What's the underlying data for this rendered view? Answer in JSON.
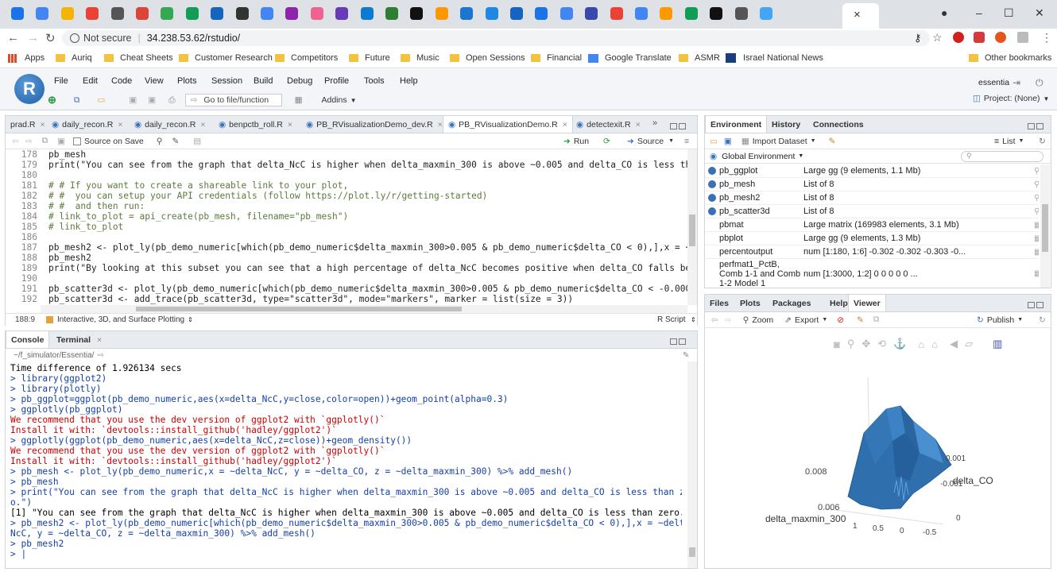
{
  "browser": {
    "active_tab_close": "×",
    "security": "Not secure",
    "url": "34.238.53.62/rstudio/",
    "bookmarks": [
      "Apps",
      "Auriq",
      "Cheat Sheets",
      "Customer Research",
      "Competitors",
      "Future",
      "Music",
      "Open Sessions",
      "Financial",
      "Google Translate",
      "ASMR",
      "Israel National News"
    ],
    "other_bookmarks": "Other bookmarks"
  },
  "menubar": {
    "items": [
      "File",
      "Edit",
      "Code",
      "View",
      "Plots",
      "Session",
      "Build",
      "Debug",
      "Profile",
      "Tools",
      "Help"
    ],
    "user": "essentia",
    "project": "Project: (None)",
    "goto": "Go to file/function",
    "addins": "Addins"
  },
  "editor": {
    "tabs": [
      "prad.R",
      "daily_recon.R",
      "daily_recon.R",
      "benpctb_roll.R",
      "PB_RVisualizationDemo_dev.R",
      "PB_RVisualizationDemo.R",
      "detectexit.R"
    ],
    "source_on_save": "Source on Save",
    "run": "Run",
    "source": "Source",
    "lines": [
      {
        "n": "178",
        "t": "pb_mesh",
        "c": "code"
      },
      {
        "n": "179",
        "t": "print(\"You can see from the graph that delta_NcC is higher when delta_maxmin_300 is above ~0.005 and delta_CO is less than",
        "c": "code"
      },
      {
        "n": "180",
        "t": "",
        "c": "code"
      },
      {
        "n": "181",
        "t": "# # If you want to create a shareable link to your plot,",
        "c": "cmt"
      },
      {
        "n": "182",
        "t": "# #  you can setup your API credentials (follow https://plot.ly/r/getting-started)",
        "c": "cmt"
      },
      {
        "n": "183",
        "t": "# #  and then run:",
        "c": "cmt"
      },
      {
        "n": "184",
        "t": "# link_to_plot = api_create(pb_mesh, filename=\"pb_mesh\")",
        "c": "cmt"
      },
      {
        "n": "185",
        "t": "# link_to_plot",
        "c": "cmt"
      },
      {
        "n": "186",
        "t": "",
        "c": "code"
      },
      {
        "n": "187",
        "t": "pb_mesh2 <- plot_ly(pb_demo_numeric[which(pb_demo_numeric$delta_maxmin_300>0.005 & pb_demo_numeric$delta_CO < 0),],x = ~de",
        "c": "code"
      },
      {
        "n": "188",
        "t": "pb_mesh2",
        "c": "code"
      },
      {
        "n": "189",
        "t": "print(\"By looking at this subset you can see that a high percentage of delta_NcC becomes positive when delta_CO falls bell",
        "c": "code"
      },
      {
        "n": "190",
        "t": "",
        "c": "code"
      },
      {
        "n": "191",
        "t": "pb_scatter3d <- plot_ly(pb_demo_numeric[which(pb_demo_numeric$delta_maxmin_300>0.005 & pb_demo_numeric$delta_CO < -0.0005)",
        "c": "code"
      },
      {
        "n": "192",
        "t": "pb_scatter3d <- add_trace(pb_scatter3d, type=\"scatter3d\", mode=\"markers\", marker = list(size = 3))",
        "c": "code"
      },
      {
        "n": "193",
        "t": "",
        "c": "code"
      }
    ],
    "status_pos": "188:9",
    "status_section": "Interactive, 3D, and Surface Plotting",
    "status_type": "R Script"
  },
  "console": {
    "tabs": [
      "Console",
      "Terminal"
    ],
    "path": "~/f_simulator/Essentia/",
    "lines": [
      {
        "t": "Time difference of 1.926134 secs",
        "c": "blk"
      },
      {
        "t": "> library(ggplot2)",
        "c": "blue"
      },
      {
        "t": "> library(plotly)",
        "c": "blue"
      },
      {
        "t": "> pb_ggplot=ggplot(pb_demo_numeric,aes(x=delta_NcC,y=close,color=open))+geom_point(alpha=0.3)",
        "c": "blue"
      },
      {
        "t": "> ggplotly(pb_ggplot)",
        "c": "blue"
      },
      {
        "t": "We recommend that you use the dev version of ggplot2 with `ggplotly()`",
        "c": "red"
      },
      {
        "t": "Install it with: `devtools::install_github('hadley/ggplot2')`",
        "c": "red"
      },
      {
        "t": "> ggplotly(ggplot(pb_demo_numeric,aes(x=delta_NcC,z=close))+geom_density())",
        "c": "blue"
      },
      {
        "t": "We recommend that you use the dev version of ggplot2 with `ggplotly()`",
        "c": "red"
      },
      {
        "t": "Install it with: `devtools::install_github('hadley/ggplot2')`",
        "c": "red"
      },
      {
        "t": "> pb_mesh <- plot_ly(pb_demo_numeric,x = ~delta_NcC, y = ~delta_CO, z = ~delta_maxmin_300) %>% add_mesh()",
        "c": "blue"
      },
      {
        "t": "> pb_mesh",
        "c": "blue"
      },
      {
        "t": "> print(\"You can see from the graph that delta_NcC is higher when delta_maxmin_300 is above ~0.005 and delta_CO is less than zer",
        "c": "blue"
      },
      {
        "t": "o.\")",
        "c": "blue"
      },
      {
        "t": "[1] \"You can see from the graph that delta_NcC is higher when delta_maxmin_300 is above ~0.005 and delta_CO is less than zero.\"",
        "c": "blk"
      },
      {
        "t": "> pb_mesh2 <- plot_ly(pb_demo_numeric[which(pb_demo_numeric$delta_maxmin_300>0.005 & pb_demo_numeric$delta_CO < 0),],x = ~delta_",
        "c": "blue"
      },
      {
        "t": "NcC, y = ~delta_CO, z = ~delta_maxmin_300) %>% add_mesh()",
        "c": "blue"
      },
      {
        "t": "> pb_mesh2",
        "c": "blue"
      },
      {
        "t": "> |",
        "c": "blue"
      }
    ]
  },
  "environment": {
    "tabs": [
      "Environment",
      "History",
      "Connections"
    ],
    "import": "Import Dataset",
    "list": "List",
    "global": "Global Environment",
    "rows": [
      {
        "name": "pb_ggplot",
        "value": "Large gg (9 elements, 1.1 Mb)"
      },
      {
        "name": "pb_mesh",
        "value": "List of 8"
      },
      {
        "name": "pb_mesh2",
        "value": "List of 8"
      },
      {
        "name": "pb_scatter3d",
        "value": "List of 8"
      },
      {
        "name": "pbmat",
        "value": "Large matrix (169983 elements, 3.1 Mb)"
      },
      {
        "name": "pbplot",
        "value": "Large gg (9 elements, 1.3 Mb)"
      },
      {
        "name": "percentoutput",
        "value": "num [1:180, 1:6] -0.302 -0.302 -0.303 -0..."
      },
      {
        "name": "perfmat1_PctB, Comb 1-1 and Comb 1-2 Model 1",
        "value": "num [1:3000, 1:2] 0 0 0 0 0 ..."
      }
    ]
  },
  "viewer": {
    "tabs": [
      "Files",
      "Plots",
      "Packages",
      "Help",
      "Viewer"
    ],
    "zoom": "Zoom",
    "export": "Export",
    "publish": "Publish",
    "plot": {
      "xlabel": "delta_maxmin_300",
      "ylabel": "delta_CO",
      "ticks_left": [
        "0.008",
        "0.006"
      ],
      "ticks_bottom": [
        "1",
        "0.5",
        "0",
        "-0.5"
      ],
      "ticks_right": [
        "0.001",
        "-0.001",
        "0"
      ],
      "color": "#2f6fad"
    }
  }
}
